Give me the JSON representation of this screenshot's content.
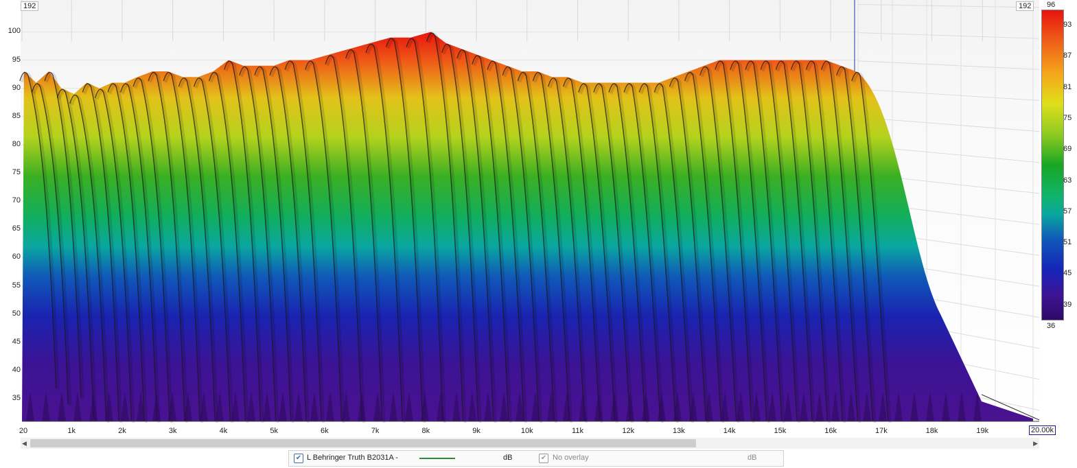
{
  "chart_data": {
    "type": "area",
    "subtype": "3d-waterfall",
    "title": "",
    "xlabel": "",
    "ylabel": "",
    "x_ticks": [
      "20",
      "1k",
      "2k",
      "3k",
      "4k",
      "5k",
      "6k",
      "7k",
      "8k",
      "9k",
      "10k",
      "11k",
      "12k",
      "13k",
      "14k",
      "15k",
      "16k",
      "17k",
      "18k",
      "19k",
      "20.00k"
    ],
    "x_tick_values": [
      20,
      1000,
      2000,
      3000,
      4000,
      5000,
      6000,
      7000,
      8000,
      9000,
      10000,
      11000,
      12000,
      13000,
      14000,
      15000,
      16000,
      17000,
      18000,
      19000,
      20000
    ],
    "xlim": [
      20,
      20000
    ],
    "y_ticks": [
      "100",
      "95",
      "90",
      "85",
      "80",
      "75",
      "70",
      "65",
      "60",
      "55",
      "50",
      "45",
      "40",
      "35"
    ],
    "ylim": [
      31,
      102
    ],
    "depth_label_left": "192",
    "depth_label_right": "192",
    "series": [
      {
        "name": "L Behringer Truth B2031A -",
        "x": [
          60,
          300,
          550,
          800,
          1050,
          1300,
          1550,
          1800,
          2050,
          2300,
          2600,
          2900,
          3200,
          3500,
          3800,
          4100,
          4400,
          4700,
          5000,
          5300,
          5700,
          6100,
          6500,
          6900,
          7300,
          7700,
          8100,
          8400,
          8700,
          9000,
          9300,
          9600,
          9900,
          10200,
          10500,
          10800,
          11100,
          11400,
          11700,
          12000,
          12300,
          12600,
          12900,
          13200,
          13500,
          13800,
          14100,
          14400,
          14700,
          15000,
          15300,
          15600,
          15900,
          16200,
          16500
        ],
        "values": [
          93,
          91,
          93,
          90,
          89,
          91,
          90,
          91,
          91,
          92,
          93,
          93,
          92,
          92,
          93,
          95,
          94,
          94,
          94,
          95,
          95,
          96,
          97,
          98,
          99,
          99,
          100,
          98,
          97,
          96,
          95,
          94,
          93,
          93,
          92,
          92,
          91,
          91,
          91,
          91,
          91,
          91,
          92,
          93,
          94,
          95,
          95,
          95,
          95,
          95,
          95,
          95,
          95,
          94,
          93
        ]
      }
    ],
    "color_scale": {
      "labels": [
        "93",
        "87",
        "81",
        "75",
        "69",
        "63",
        "57",
        "51",
        "45",
        "39"
      ],
      "max_label": "96",
      "min_label": "36",
      "colors": [
        "#e8130f",
        "#f5a31b",
        "#e0df1b",
        "#19a623",
        "#0aa7a0",
        "#1623b8",
        "#2f0a67"
      ]
    },
    "grid": true
  },
  "legend": {
    "primary": {
      "label": "L Behringer Truth B2031A -",
      "unit": "dB",
      "checked": true,
      "line_color": "#2a8a3a"
    },
    "overlay": {
      "label": "No overlay",
      "unit": "dB",
      "checked": true
    }
  }
}
